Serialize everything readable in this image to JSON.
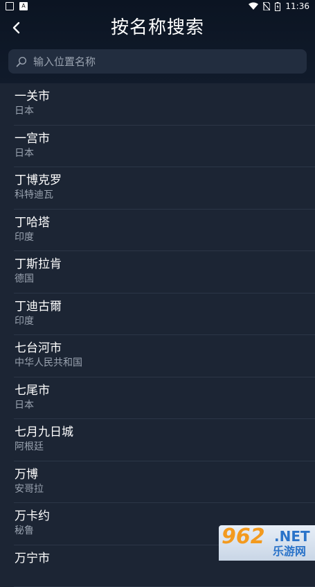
{
  "status_bar": {
    "time": "11:36"
  },
  "header": {
    "title": "按名称搜索"
  },
  "search": {
    "placeholder": "输入位置名称",
    "value": ""
  },
  "results": [
    {
      "name": "一关市",
      "country": "日本"
    },
    {
      "name": "一宫市",
      "country": "日本"
    },
    {
      "name": "丁博克罗",
      "country": "科特迪瓦"
    },
    {
      "name": "丁哈塔",
      "country": "印度"
    },
    {
      "name": "丁斯拉肯",
      "country": "德国"
    },
    {
      "name": "丁迪古爾",
      "country": "印度"
    },
    {
      "name": "七台河市",
      "country": "中华人民共和国"
    },
    {
      "name": "七尾市",
      "country": "日本"
    },
    {
      "name": "七月九日城",
      "country": "阿根廷"
    },
    {
      "name": "万博",
      "country": "安哥拉"
    },
    {
      "name": "万卡约",
      "country": "秘鲁"
    },
    {
      "name": "万宁市",
      "country": ""
    }
  ],
  "watermark": {
    "number": "962",
    "domain": ".NET",
    "text": "乐游网"
  },
  "colors": {
    "background": "#1c2534",
    "header": "#0b1422",
    "secondary_text": "#9aa3b0"
  }
}
